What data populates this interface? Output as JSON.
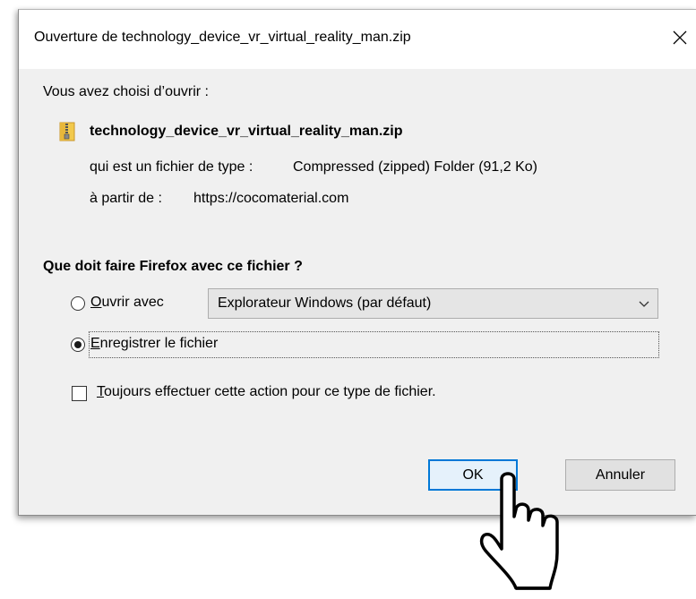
{
  "dialog": {
    "title": "Ouverture de technology_device_vr_virtual_reality_man.zip",
    "intro": "Vous avez choisi d’ouvrir :",
    "file_name": "technology_device_vr_virtual_reality_man.zip",
    "type_label": "qui est un fichier de type :",
    "type_value": "Compressed (zipped) Folder (91,2 Ko)",
    "from_label": "à partir de :",
    "from_value": "https://cocomaterial.com"
  },
  "question": "Que doit faire Firefox avec ce fichier ?",
  "options": {
    "open_with": {
      "accel": "O",
      "rest": "uvrir avec",
      "selected": false,
      "app": "Explorateur Windows (par défaut)"
    },
    "save_file": {
      "accel": "E",
      "rest": "nregistrer le fichier",
      "selected": true
    },
    "always": {
      "accel": "T",
      "rest": "oujours effectuer cette action pour ce type de fichier.",
      "checked": false
    }
  },
  "buttons": {
    "ok": "OK",
    "cancel": "Annuler"
  },
  "icons": {
    "close": "close-icon",
    "file": "zip-file-icon",
    "chevron": "chevron-down-icon",
    "pointer": "hand-pointer-icon"
  },
  "colors": {
    "accent": "#0078d7",
    "dialog_bg": "#f0f0f0"
  }
}
